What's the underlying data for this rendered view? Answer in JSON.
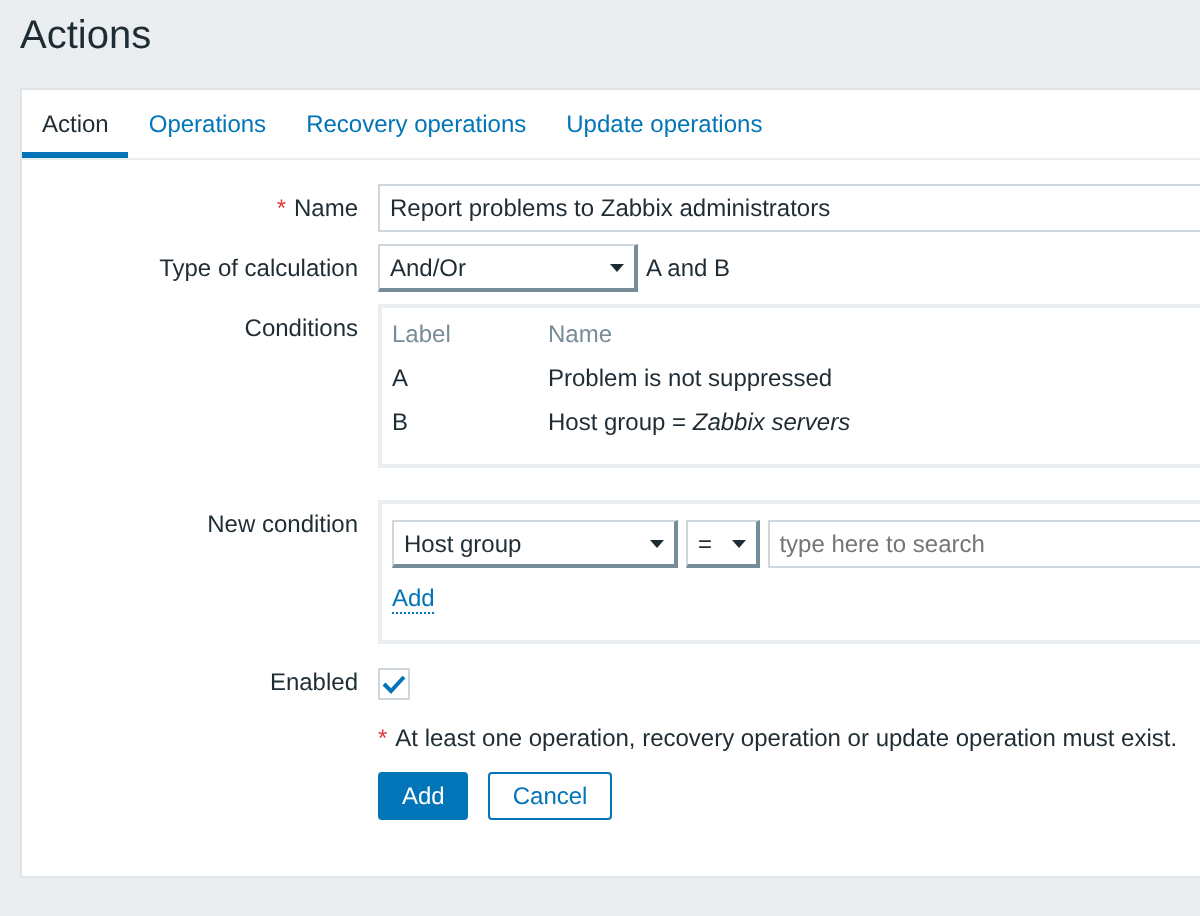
{
  "page_title": "Actions",
  "tabs": [
    {
      "label": "Action",
      "selected": true
    },
    {
      "label": "Operations",
      "selected": false
    },
    {
      "label": "Recovery operations",
      "selected": false
    },
    {
      "label": "Update operations",
      "selected": false
    }
  ],
  "name_field": {
    "label": "Name",
    "required_mark": "*",
    "value": "Report problems to Zabbix administrators"
  },
  "calculation": {
    "label": "Type of calculation",
    "value": "And/Or",
    "formula": "A and B"
  },
  "conditions": {
    "label": "Conditions",
    "columns": [
      "Label",
      "Name"
    ],
    "rows": [
      {
        "label": "A",
        "name": "Problem is not suppressed"
      },
      {
        "label": "B",
        "name": "Host group = *Zabbix servers*"
      }
    ]
  },
  "new_condition": {
    "label": "New condition",
    "type": "Host group",
    "operator": "=",
    "placeholder": "type here to search",
    "add_link": "Add"
  },
  "enabled": {
    "label": "Enabled",
    "checked": true
  },
  "note_mark": "*",
  "note": "At least one operation, recovery operation or update operation must exist.",
  "buttons": [
    {
      "label": "Add",
      "kind": "primary"
    },
    {
      "label": "Cancel",
      "kind": "secondary"
    }
  ]
}
